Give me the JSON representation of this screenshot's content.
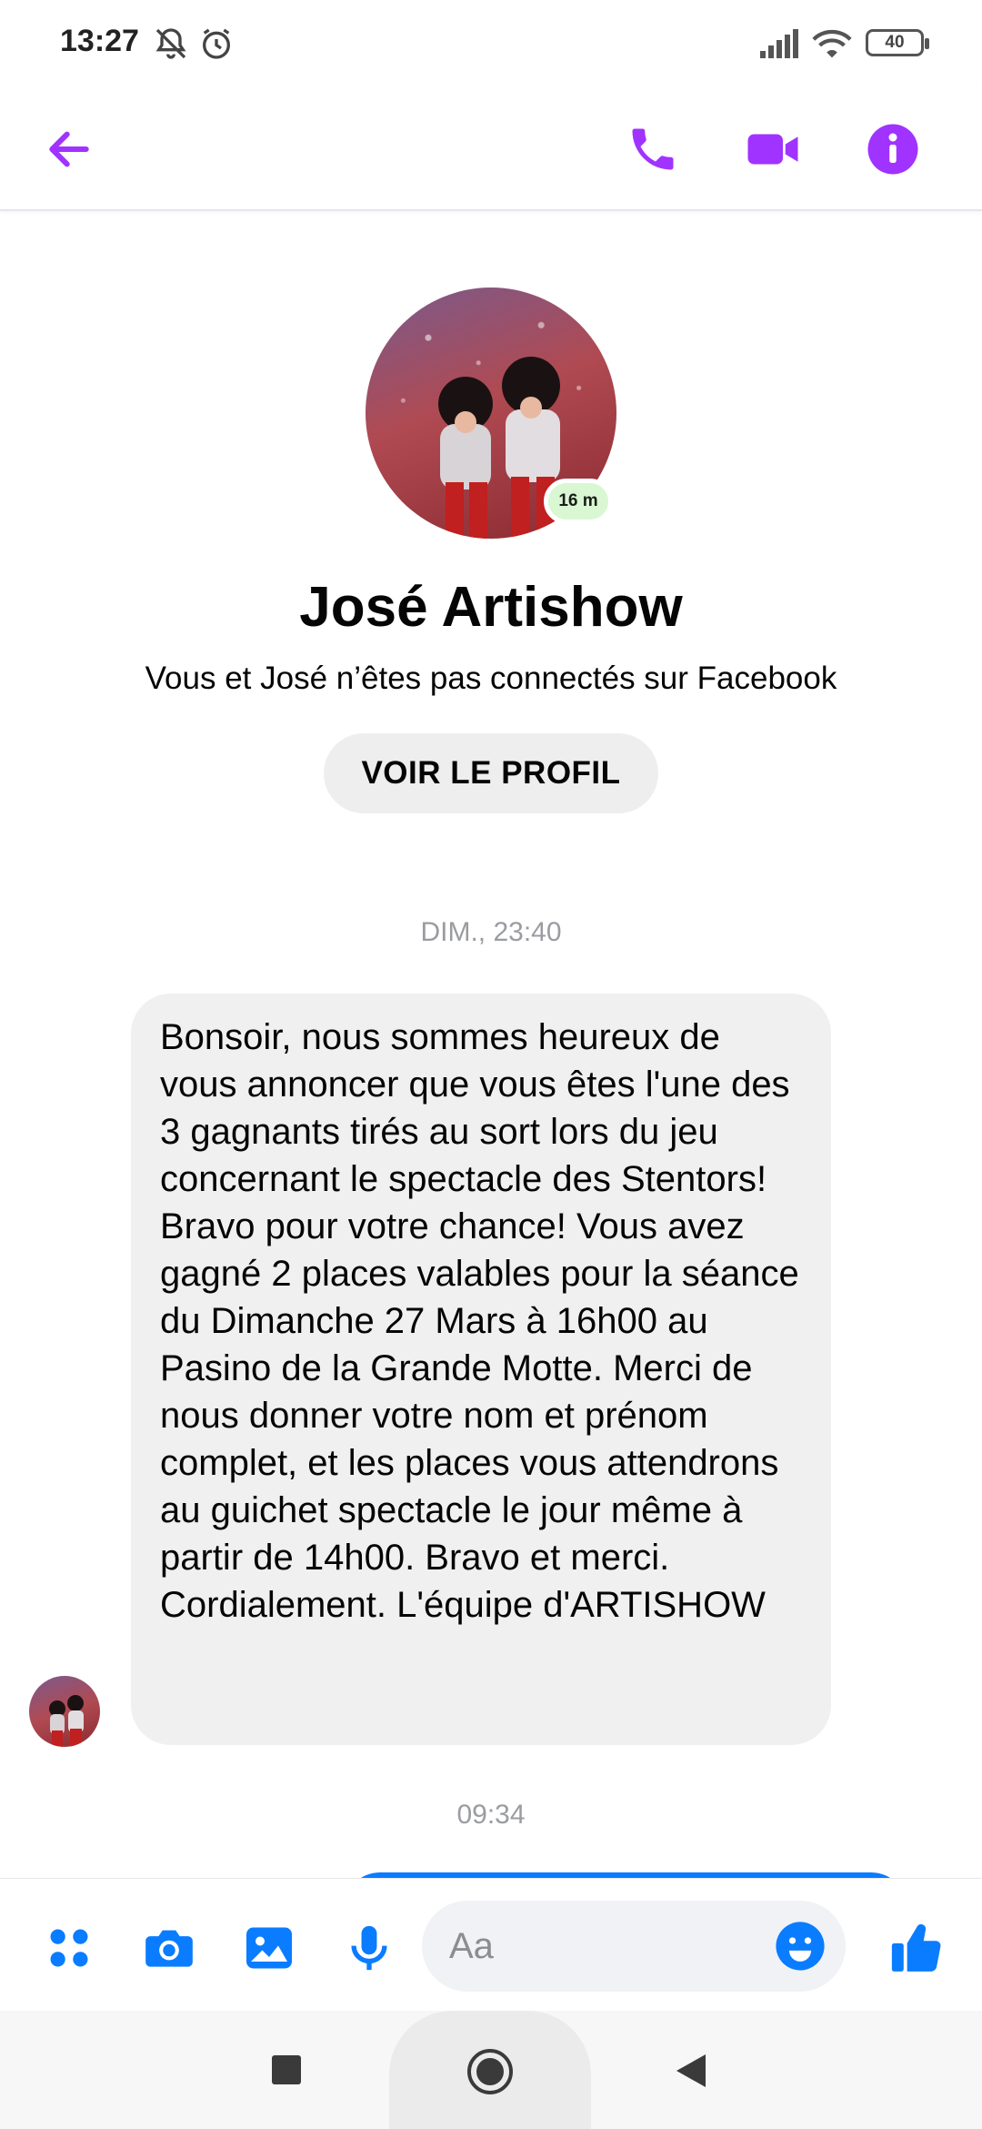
{
  "status_bar": {
    "time": "13:27",
    "battery": "40"
  },
  "header": {
    "back_icon": "arrow-left-icon",
    "call_icon": "phone-icon",
    "video_icon": "video-camera-icon",
    "info_icon": "info-icon",
    "accent_color": "#a033ff"
  },
  "profile": {
    "name": "José Artishow",
    "presence": "16 m",
    "subtitle": "Vous et José n’êtes pas connectés sur Facebook",
    "button_label": "VOIR LE PROFIL"
  },
  "messages": {
    "timestamp_1": "DIM., 23:40",
    "incoming_text": "Bonsoir, nous sommes heureux de vous annoncer que vous êtes l'une des 3 gagnants tirés au sort lors du jeu concernant le spectacle des Stentors! Bravo pour votre chance! Vous avez gagné 2 places valables pour la séance du Dimanche 27 Mars à 16h00 au Pasino de la Grande Motte. Merci de nous donner votre nom et prénom complet, et les places vous attendrons au guichet spectacle le jour même à partir de 14h00. Bravo et merci. Cordialement. L'équipe d'ARTISHOW",
    "timestamp_2": "09:34"
  },
  "composer": {
    "placeholder": "Aa",
    "icons": [
      "apps-icon",
      "camera-icon",
      "image-icon",
      "microphone-icon",
      "emoji-icon",
      "thumbs-up-icon"
    ],
    "accent_color": "#0a7cff"
  },
  "navbar": {
    "icons": [
      "recents-icon",
      "home-icon",
      "back-icon"
    ]
  }
}
